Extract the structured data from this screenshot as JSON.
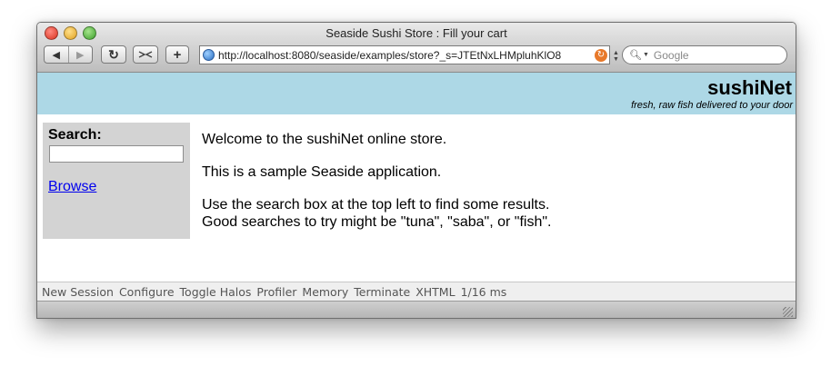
{
  "window": {
    "title": "Seaside Sushi Store : Fill your cart"
  },
  "toolbar": {
    "back_icon": "◀",
    "forward_icon": "▶",
    "reload_icon": "↻",
    "add_icon": "+",
    "url": "http://localhost:8080/seaside/examples/store?_s=JTEtNxLHMpluhKlO8",
    "search_placeholder": "Google"
  },
  "header": {
    "site_title": "sushiNet",
    "tagline": "fresh, raw fish delivered to your door",
    "background_color": "#add8e6"
  },
  "sidebar": {
    "search_label": "Search:",
    "search_value": "",
    "browse_link": "Browse",
    "background_color": "#d3d3d3"
  },
  "content": {
    "welcome": "Welcome to the sushiNet online store.",
    "sample": "This is a sample Seaside application.",
    "hint_line1": "Use the search box at the top left to find some results.",
    "hint_line2": "Good searches to try might be \"tuna\", \"saba\", or \"fish\"."
  },
  "footer": {
    "links": [
      "New Session",
      "Configure",
      "Toggle Halos",
      "Profiler",
      "Memory",
      "Terminate",
      "XHTML"
    ],
    "timing": "1/16 ms"
  }
}
